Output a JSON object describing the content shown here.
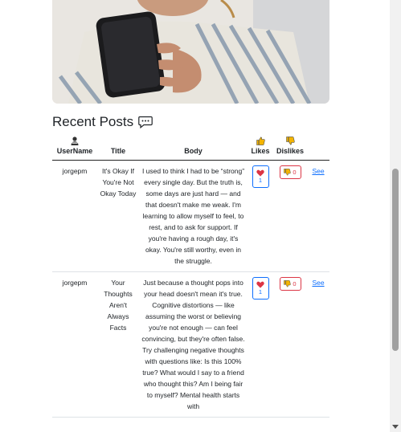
{
  "section": {
    "title": "Recent Posts",
    "icon": "chat-dots-icon"
  },
  "table": {
    "headers": {
      "username": "UserName",
      "title": "Title",
      "body": "Body",
      "likes": "Likes",
      "dislikes": "Dislikes"
    },
    "rows": [
      {
        "username": "jorgepm",
        "title": "It's Okay If You're Not Okay Today",
        "body": "I used to think I had to be “strong” every single day. But the truth is, some days are just hard — and that doesn't make me weak. I'm learning to allow myself to feel, to rest, and to ask for support. If you're having a rough day, it's okay. You're still worthy, even in the struggle.",
        "likes": "1",
        "dislikes": "0",
        "link": "See"
      },
      {
        "username": "jorgepm",
        "title": "Your Thoughts Aren't Always Facts",
        "body": "Just because a thought pops into your head doesn't mean it's true. Cognitive distortions — like assuming the worst or believing you're not enough — can feel convincing, but they're often false. Try challenging negative thoughts with questions like: Is this 100% true? What would I say to a friend who thought this? Am I being fair to myself? Mental health starts with",
        "likes": "1",
        "dislikes": "0",
        "link": "See"
      }
    ]
  },
  "colors": {
    "primary": "#0d6efd",
    "danger": "#dc3545",
    "heart": "#dc3545",
    "thumb": "#f4b400"
  }
}
